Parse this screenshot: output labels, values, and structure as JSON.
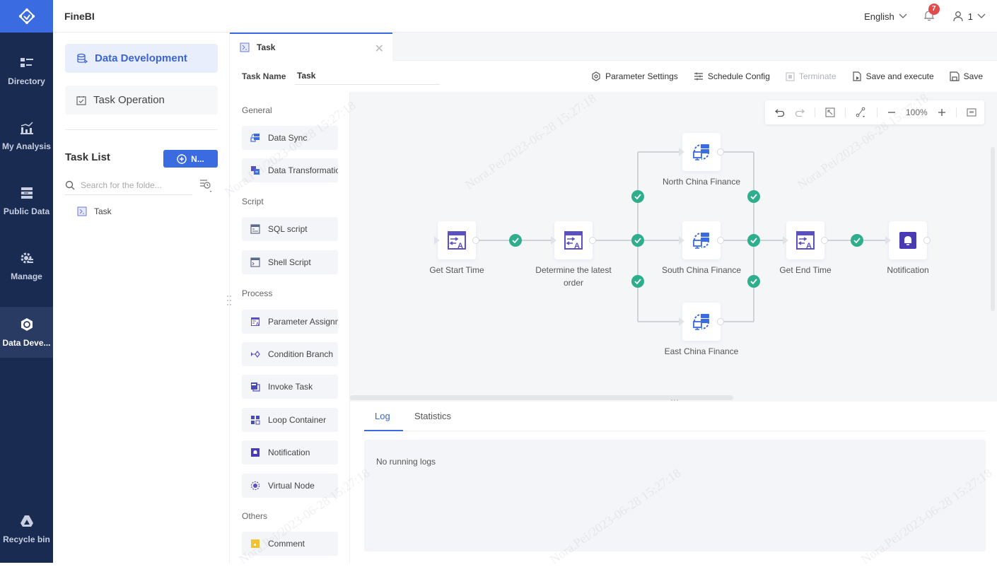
{
  "app": {
    "brand": "FineBI",
    "language": "English",
    "notification_count": "7",
    "user": "1"
  },
  "rail": {
    "items": [
      {
        "label": "Directory",
        "icon": "directory-icon"
      },
      {
        "label": "My Analysis",
        "icon": "analysis-icon"
      },
      {
        "label": "Public Data",
        "icon": "public-data-icon"
      },
      {
        "label": "Manage",
        "icon": "manage-icon"
      },
      {
        "label": "Data Deve...",
        "icon": "data-development-icon",
        "active": true
      },
      {
        "label": "Recycle bin",
        "icon": "recycle-bin-icon"
      }
    ]
  },
  "panel": {
    "menu": [
      {
        "label": "Data Development",
        "active": true
      },
      {
        "label": "Task Operation",
        "active": false
      }
    ],
    "task_list_title": "Task List",
    "new_button": "N...",
    "search_placeholder": "Search for the folde...",
    "tree": [
      {
        "label": "Task"
      }
    ]
  },
  "editor": {
    "tab_label": "Task",
    "task_name_label": "Task Name",
    "task_name_value": "Task",
    "actions": [
      {
        "label": "Parameter Settings",
        "icon": "gear-icon",
        "disabled": false
      },
      {
        "label": "Schedule Config",
        "icon": "sliders-icon",
        "disabled": false
      },
      {
        "label": "Terminate",
        "icon": "stop-icon",
        "disabled": true
      },
      {
        "label": "Save and execute",
        "icon": "save-run-icon",
        "disabled": false
      },
      {
        "label": "Save",
        "icon": "save-icon",
        "disabled": false
      }
    ],
    "zoom_level": "100%"
  },
  "palette": {
    "groups": [
      {
        "title": "General",
        "items": [
          {
            "label": "Data Sync",
            "icon": "data-sync-icon"
          },
          {
            "label": "Data Transformation",
            "icon": "data-transformation-icon"
          }
        ]
      },
      {
        "title": "Script",
        "items": [
          {
            "label": "SQL script",
            "icon": "sql-script-icon"
          },
          {
            "label": "Shell Script",
            "icon": "shell-script-icon"
          }
        ]
      },
      {
        "title": "Process",
        "items": [
          {
            "label": "Parameter Assignment",
            "icon": "parameter-assignment-icon"
          },
          {
            "label": "Condition Branch",
            "icon": "condition-branch-icon"
          },
          {
            "label": "Invoke Task",
            "icon": "invoke-task-icon"
          },
          {
            "label": "Loop Container",
            "icon": "loop-container-icon"
          },
          {
            "label": "Notification",
            "icon": "notification-icon"
          },
          {
            "label": "Virtual Node",
            "icon": "virtual-node-icon"
          }
        ]
      },
      {
        "title": "Others",
        "items": [
          {
            "label": "Comment",
            "icon": "comment-icon"
          }
        ]
      }
    ]
  },
  "flow": {
    "nodes": [
      {
        "id": "n1",
        "label": "Get Start Time",
        "type": "parameter-assignment",
        "status": "success"
      },
      {
        "id": "n2",
        "label": "Determine the latest order",
        "type": "parameter-assignment",
        "status": "success"
      },
      {
        "id": "n3",
        "label": "North China Finance",
        "type": "data-sync",
        "status": "success"
      },
      {
        "id": "n4",
        "label": "South China Finance",
        "type": "data-sync",
        "status": "success"
      },
      {
        "id": "n5",
        "label": "East China Finance",
        "type": "data-sync",
        "status": "success"
      },
      {
        "id": "n6",
        "label": "Get End Time",
        "type": "parameter-assignment",
        "status": "success"
      },
      {
        "id": "n7",
        "label": "Notification",
        "type": "notification",
        "status": "success"
      }
    ],
    "edges": [
      [
        "n1",
        "n2"
      ],
      [
        "n2",
        "n3"
      ],
      [
        "n2",
        "n4"
      ],
      [
        "n2",
        "n5"
      ],
      [
        "n3",
        "n6"
      ],
      [
        "n4",
        "n6"
      ],
      [
        "n5",
        "n6"
      ],
      [
        "n6",
        "n7"
      ]
    ]
  },
  "log": {
    "tabs": [
      {
        "label": "Log",
        "active": true
      },
      {
        "label": "Statistics",
        "active": false
      }
    ],
    "message": "No running logs"
  },
  "watermark": "Nora.Pei/2023-06-28 15:27:18",
  "colors": {
    "rail": "#1a2b52",
    "accent": "#3a6be0",
    "success": "#2fae8e",
    "node_icon": "#5b4fc4",
    "badge": "#e24b4b"
  }
}
